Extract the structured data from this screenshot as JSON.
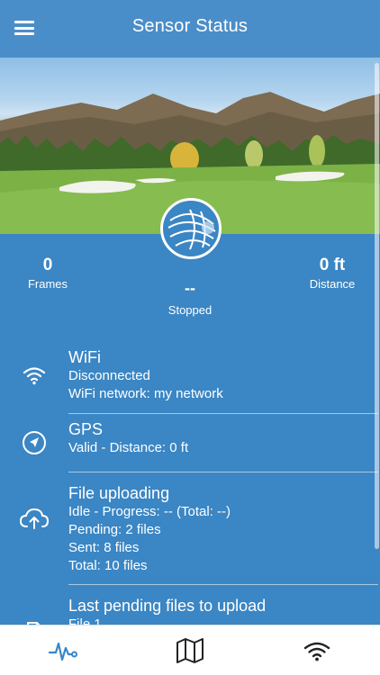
{
  "header": {
    "title": "Sensor Status",
    "menu_icon": "hamburger-menu-icon"
  },
  "stats": {
    "frames_value": "0",
    "frames_label": "Frames",
    "distance_value": "0 ft",
    "distance_label": "Distance",
    "status_value": "--",
    "status_label": "Stopped"
  },
  "list": {
    "wifi": {
      "icon": "wifi-icon",
      "title": "WiFi",
      "line1": "Disconnected",
      "line2": "WiFi network: my network"
    },
    "gps": {
      "icon": "navigation-arrow-icon",
      "title": "GPS",
      "line1": "Valid - Distance: 0 ft"
    },
    "upload": {
      "icon": "cloud-upload-icon",
      "title": "File uploading",
      "line1": "Idle - Progress: -- (Total: --)",
      "line2": "Pending: 2 files",
      "line3": "Sent: 8 files",
      "line4": "Total: 10 files"
    },
    "pending": {
      "icon": "files-icon",
      "title": "Last pending files to upload",
      "line1": "File 1"
    }
  },
  "bottom_nav": {
    "items": [
      {
        "icon": "activity-pulse-icon",
        "active": true
      },
      {
        "icon": "map-icon",
        "active": false
      },
      {
        "icon": "wifi-icon",
        "active": false
      }
    ]
  },
  "colors": {
    "primary": "#3b86c4",
    "header": "#4a8ec9",
    "nav_active": "#3b86c4",
    "nav_inactive": "#222222"
  }
}
